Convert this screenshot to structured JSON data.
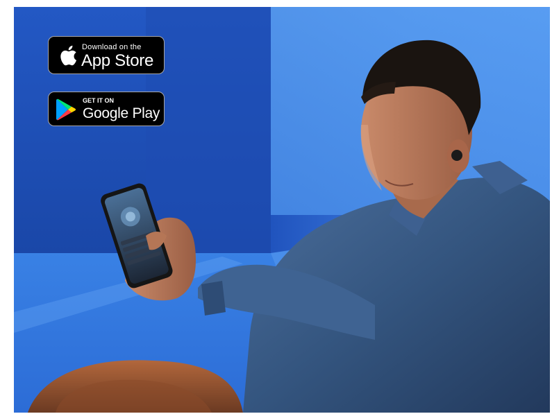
{
  "scene": {
    "description_icon": "photo",
    "background_color": "#1f4fb8"
  },
  "badges": {
    "app_store": {
      "small_text": "Download on the",
      "big_text": "App Store",
      "icon": "apple-icon"
    },
    "google_play": {
      "small_text": "GET IT ON",
      "big_text": "Google Play",
      "icon": "google-play-icon"
    }
  }
}
